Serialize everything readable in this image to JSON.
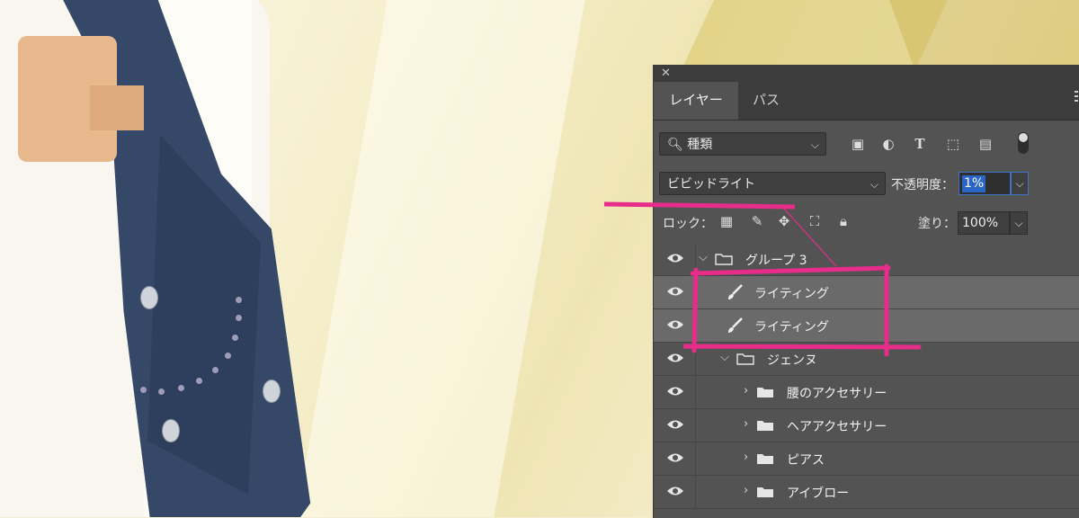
{
  "panel": {
    "tabs": [
      {
        "label": "レイヤー",
        "active": true
      },
      {
        "label": "パス",
        "active": false
      }
    ],
    "filter": {
      "label": "種類"
    },
    "blend_mode": {
      "value": "ビビッドライト"
    },
    "opacity": {
      "label": "不透明度：",
      "value": "1%"
    },
    "lock": {
      "label": "ロック："
    },
    "fill": {
      "label": "塗り：",
      "value": "100%"
    },
    "layers": [
      {
        "name": "グループ 3",
        "type": "group",
        "expanded": true,
        "indent": 0
      },
      {
        "name": "ライティング",
        "type": "pixel",
        "indent": 1
      },
      {
        "name": "ライティング",
        "type": "pixel",
        "indent": 1
      },
      {
        "name": "ジェンヌ",
        "type": "group",
        "expanded": true,
        "indent": 1
      },
      {
        "name": "腰のアクセサリー",
        "type": "group",
        "expanded": false,
        "indent": 2
      },
      {
        "name": "ヘアアクセサリー",
        "type": "group",
        "expanded": false,
        "indent": 2
      },
      {
        "name": "ピアス",
        "type": "group",
        "expanded": false,
        "indent": 2
      },
      {
        "name": "アイブロー",
        "type": "group",
        "expanded": false,
        "indent": 2
      }
    ]
  },
  "colors": {
    "panel_bg": "#535353",
    "annotation": "#e72c8a",
    "selection": "#2b65c6"
  }
}
